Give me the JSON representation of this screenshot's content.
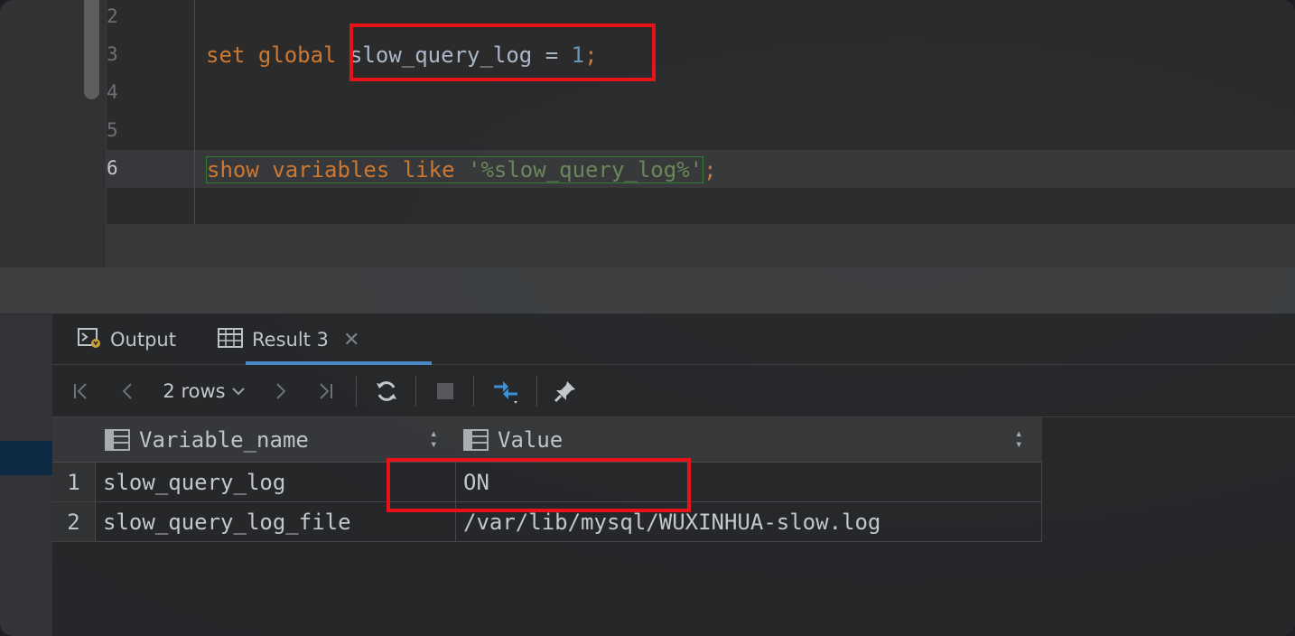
{
  "editor": {
    "line_numbers": [
      "2",
      "3",
      "4",
      "5",
      "6"
    ],
    "active_line": "6",
    "line3": {
      "kw_set": "set",
      "kw_global": "global",
      "var": "slow_query_log",
      "eq": " = ",
      "value": "1",
      "semi": ";"
    },
    "line6": {
      "kw_show": "show",
      "kw_variables": "variables",
      "kw_like": "like",
      "pattern": "'%slow_query_log%'",
      "semi": ";"
    }
  },
  "results": {
    "tabs": [
      {
        "label": "Output",
        "icon": "output-console-icon"
      },
      {
        "label": "Result 3",
        "icon": "table-grid-icon",
        "closable": true,
        "active": true
      }
    ],
    "toolbar": {
      "rows_label": "2 rows",
      "icons": [
        "first-page-icon",
        "previous-page-icon",
        "rows-dropdown-chevron-icon",
        "next-page-icon",
        "last-page-icon",
        "refresh-icon",
        "stop-icon",
        "compare-arrows-icon",
        "pin-icon"
      ]
    },
    "table": {
      "columns": [
        "Variable_name",
        "Value"
      ],
      "rows": [
        {
          "num": "1",
          "Variable_name": "slow_query_log",
          "Value": "ON"
        },
        {
          "num": "2",
          "Variable_name": "slow_query_log_file",
          "Value": "/var/lib/mysql/WUXINHUA-slow.log"
        }
      ]
    }
  },
  "colors": {
    "keyword": "#cc7832",
    "identifier": "#a9b7c6",
    "number": "#6897bb",
    "string": "#6a8759",
    "highlight_box": "#e8121a",
    "tab_accent": "#4a88c7"
  }
}
